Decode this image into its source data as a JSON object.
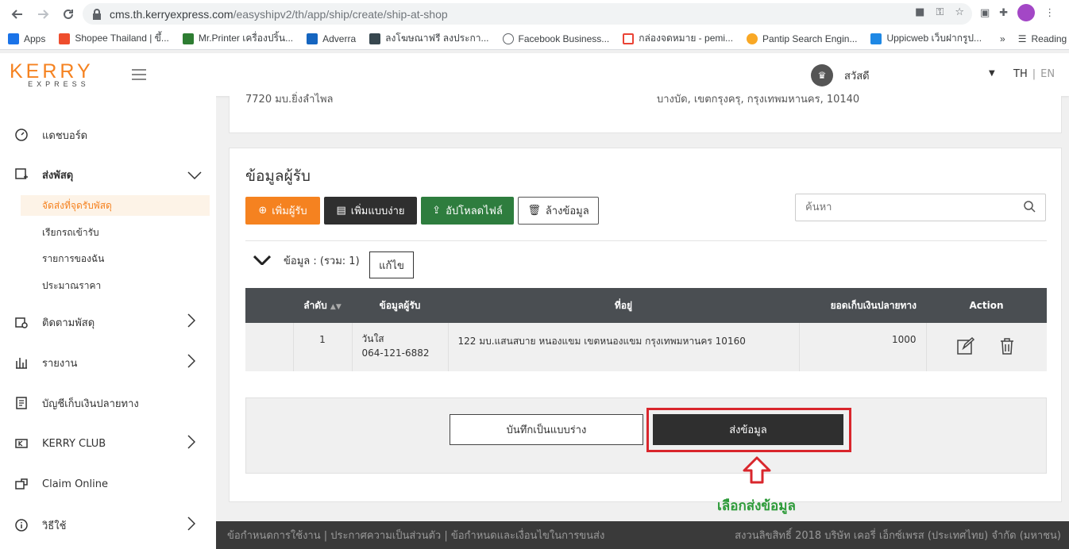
{
  "browser": {
    "url_host": "cms.th.kerryexpress.com",
    "url_path": "/easyshipv2/th/app/ship/create/ship-at-shop",
    "bookmarks": [
      {
        "label": "Apps",
        "color": "#1a73e8"
      },
      {
        "label": "Shopee Thailand | ขึ้...",
        "color": "#ee4d2d"
      },
      {
        "label": "Mr.Printer เครื่องปริ้น...",
        "color": "#2e7d32"
      },
      {
        "label": "Adverra",
        "color": "#1565c0"
      },
      {
        "label": "ลงโฆษณาฟรี ลงประกา...",
        "color": "#37474f"
      },
      {
        "label": "Facebook Business...",
        "color": "#5f6368"
      },
      {
        "label": "กล่องจดหมาย - pemi...",
        "color": "#ea4335"
      },
      {
        "label": "Pantip Search Engin...",
        "color": "#f9a825"
      },
      {
        "label": "Uppicweb เว็บฝากรูป...",
        "color": "#1e88e5"
      }
    ],
    "reading_list": "Reading list"
  },
  "header": {
    "logo_top": "KERRY",
    "logo_bottom": "EXPRESS",
    "greeting": "สวัสดี",
    "lang_th": "TH",
    "lang_en": "EN"
  },
  "sidebar": {
    "items": [
      {
        "label": "แดชบอร์ด",
        "icon": "dashboard-icon"
      },
      {
        "label": "ส่งพัสดุ",
        "icon": "package-icon"
      },
      {
        "label": "ติดตามพัสดุ",
        "icon": "track-icon"
      },
      {
        "label": "รายงาน",
        "icon": "report-icon"
      },
      {
        "label": "บัญชีเก็บเงินปลายทาง",
        "icon": "cod-account-icon"
      },
      {
        "label": "KERRY CLUB",
        "icon": "club-icon"
      },
      {
        "label": "Claim Online",
        "icon": "claim-icon"
      },
      {
        "label": "วิธีใช้",
        "icon": "info-icon"
      }
    ],
    "sub_items": [
      {
        "label": "จัดส่งที่จุดรับพัสดุ"
      },
      {
        "label": "เรียกรถเข้ารับ"
      },
      {
        "label": "รายการของฉัน"
      },
      {
        "label": "ประมาณราคา"
      }
    ]
  },
  "sender_address": {
    "left": "7720 มบ.ยิ่งลำไพล",
    "right": "บางบัด, เขตกรุงครุ, กรุงเทพมหานคร, 10140"
  },
  "recipient": {
    "title": "ข้อมูลผู้รับ",
    "add_button": "เพิ่มผู้รับ",
    "quick_add_button": "เพิ่มแบบง่าย",
    "upload_button": "อัปโหลดไฟล์",
    "clear_button": "ล้างข้อมูล",
    "search_placeholder": "ค้นหา",
    "summary": "ข้อมูล : (รวม: 1)",
    "edit_button": "แก้ไข",
    "columns": {
      "index": "ลำดับ",
      "recipient": "ข้อมูลผู้รับ",
      "address": "ที่อยู่",
      "cod": "ยอดเก็บเงินปลายทาง",
      "action": "Action"
    },
    "rows": [
      {
        "index": "1",
        "name": "วันใส",
        "phone": "064-121-6882",
        "address": "122 มบ.แสนสบาย หนองแขม เขตหนองแขม กรุงเทพมหานคร 10160",
        "cod": "1000"
      }
    ],
    "draft_button": "บันทึกเป็นแบบร่าง",
    "submit_button": "ส่งข้อมูล",
    "hint": "เลือกส่งข้อมูล"
  },
  "footer": {
    "links": "ข้อกำหนดการใช้งาน | ประกาศความเป็นส่วนตัว | ข้อกำหนดและเงื่อนไขในการขนส่ง",
    "copyright": "สงวนลิขสิทธิ์ 2018 บริษัท เคอรี่ เอ็กซ์เพรส (ประเทศไทย) จำกัด (มหาชน)"
  },
  "colors": {
    "brand_orange": "#f58220",
    "highlight_red": "#d9262c",
    "hint_green": "#2e9b3a"
  }
}
